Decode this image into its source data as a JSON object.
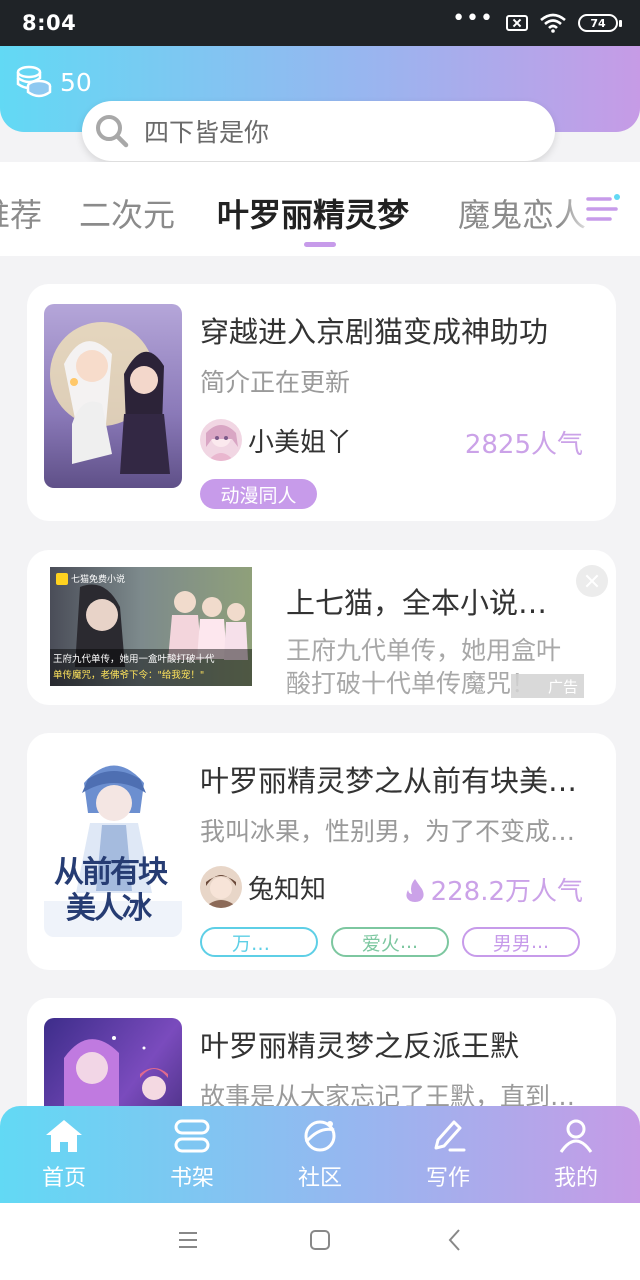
{
  "status_bar": {
    "time": "8:04",
    "dots": "•••",
    "battery": "74"
  },
  "header": {
    "coins": "50"
  },
  "search": {
    "text": "四下皆是你"
  },
  "tabs": [
    {
      "label": "推荐"
    },
    {
      "label": "二次元"
    },
    {
      "label": "叶罗丽精灵梦"
    },
    {
      "label": "魔鬼恋人"
    }
  ],
  "books": [
    {
      "title": "穿越进入京剧猫变成神助功",
      "desc": "简介正在更新",
      "author": "小美姐丫",
      "popularity": "2825人气",
      "tags": [
        "动漫同人"
      ]
    },
    {
      "title": "叶罗丽精灵梦之从前有块美人冰",
      "desc": "我叫冰果，性别男，为了不变成女生",
      "author": "兔知知",
      "popularity": "228.2万人气",
      "cover_line1": "从前有块",
      "cover_line2": "美人冰",
      "tags": [
        "万人迷",
        "爱火",
        "男男"
      ]
    },
    {
      "title": "叶罗丽精灵梦之反派王默",
      "desc": "故事是从大家忘记了王默，直到有一天"
    }
  ],
  "ad": {
    "title": "上七猫，全本小说免费看",
    "desc": "王府九代单传，她用盒叶酸打破十代单传魔咒！",
    "badge": "广告",
    "image_brand": "七猫免费小说",
    "image_caption_1": "王府九代单传，她用一盒叶酸打破十代",
    "image_caption_2": "单传魔咒，老佛爷下令：\"给我宠！\""
  },
  "bottom_nav": [
    {
      "label": "首页"
    },
    {
      "label": "书架"
    },
    {
      "label": "社区"
    },
    {
      "label": "写作"
    },
    {
      "label": "我的"
    }
  ],
  "colors": {
    "gradient_start": "#62d9f4",
    "gradient_end": "#c69be6",
    "accent_purple": "#cba2e8",
    "tag_cyan": "#5ecfe6",
    "tag_green": "#7dc7a0",
    "tag_purple": "#c79bea"
  }
}
